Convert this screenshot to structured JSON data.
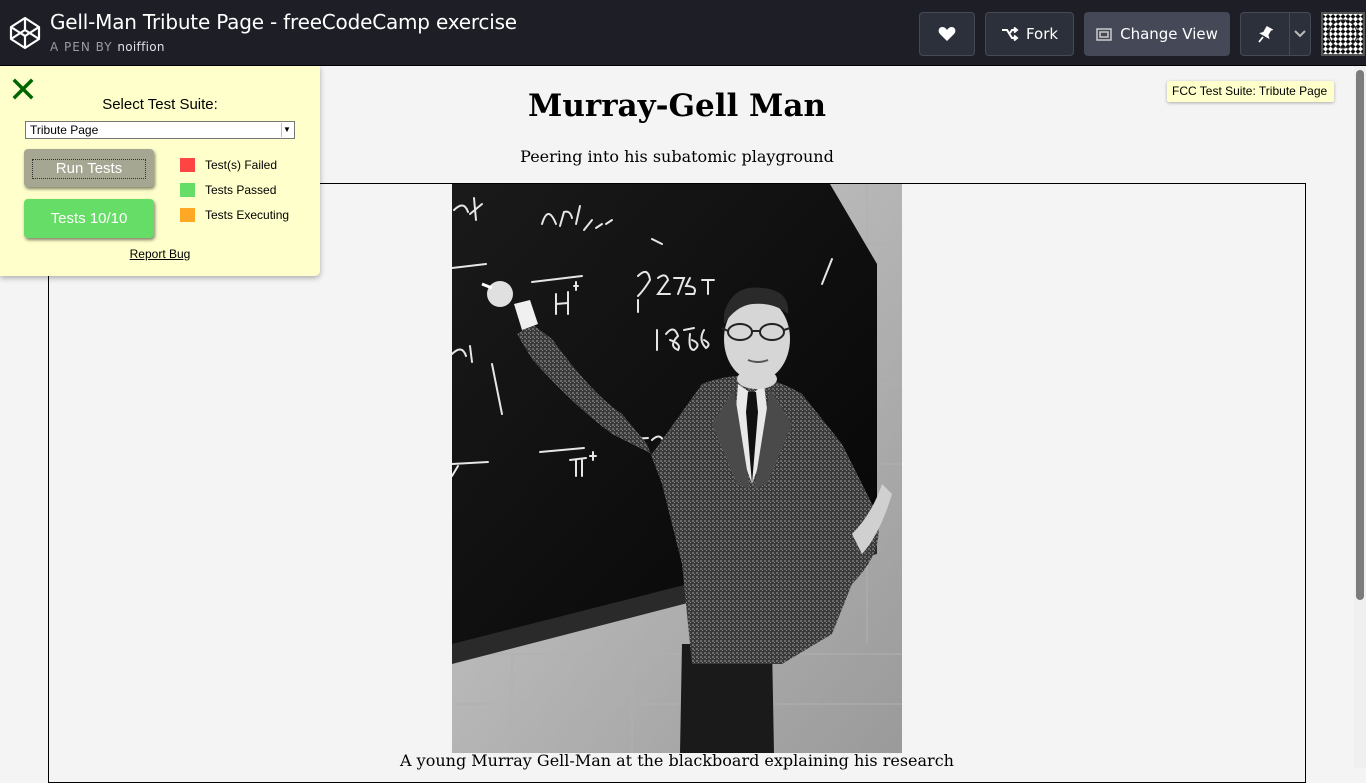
{
  "header": {
    "title": "Gell-Man Tribute Page - freeCodeCamp exercise",
    "byline_prefix": "A PEN BY",
    "author": "noiffion",
    "fork_label": "Fork",
    "change_view_label": "Change View"
  },
  "page": {
    "heading": "Murray-Gell Man",
    "subheading": "Peering into his subatomic playground",
    "caption": "A young Murray Gell-Man at the blackboard explaining his research",
    "tooltip": "FCC Test Suite: Tribute Page",
    "photo_alt": "Murray Gell-Man at a blackboard"
  },
  "test_panel": {
    "select_label": "Select Test Suite:",
    "selected_suite": "Tribute Page",
    "run_label": "Run Tests",
    "tests_label": "Tests 10/10",
    "legend": [
      {
        "label": "Test(s) Failed",
        "color": "#ff4444"
      },
      {
        "label": "Tests Passed",
        "color": "#66dd66"
      },
      {
        "label": "Tests Executing",
        "color": "#ffa826"
      }
    ],
    "report_label": "Report Bug"
  },
  "colors": {
    "header_bg": "#1e1f26",
    "panel_bg": "#ffffcc",
    "close_icon": "#006600",
    "tests_button": "#66dd66"
  }
}
